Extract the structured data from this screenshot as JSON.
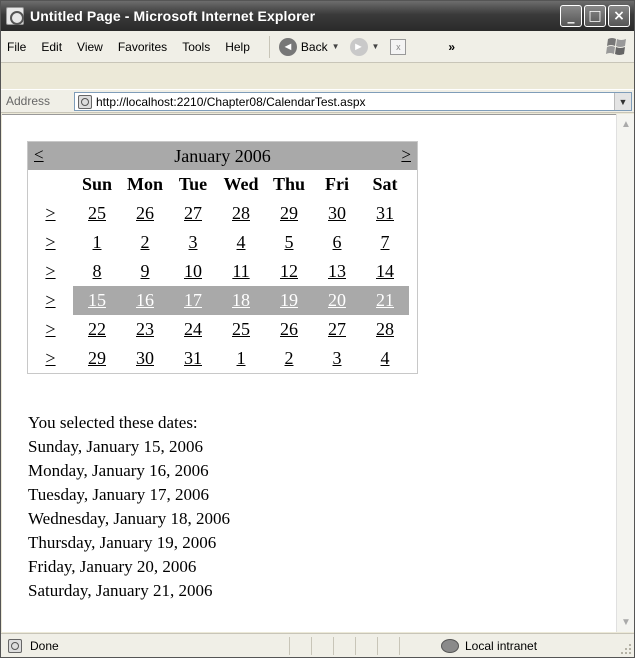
{
  "window": {
    "title": "Untitled Page - Microsoft Internet Explorer",
    "minimize": "_",
    "maximize": "□",
    "close": "×"
  },
  "menu": {
    "file": "File",
    "edit": "Edit",
    "view": "View",
    "favorites": "Favorites",
    "tools": "Tools",
    "help": "Help"
  },
  "toolbar": {
    "back": "Back",
    "back_glyph": "◄",
    "forward_glyph": "►",
    "dropdown": "▼",
    "stop_glyph": "x",
    "chevrons": "»"
  },
  "address": {
    "label": "Address",
    "url": "http://localhost:2210/Chapter08/CalendarTest.aspx"
  },
  "calendar": {
    "title": "January 2006",
    "prev": "<",
    "next": ">",
    "week_select": ">",
    "days_of_week": [
      "Sun",
      "Mon",
      "Tue",
      "Wed",
      "Thu",
      "Fri",
      "Sat"
    ],
    "weeks": [
      [
        "25",
        "26",
        "27",
        "28",
        "29",
        "30",
        "31"
      ],
      [
        "1",
        "2",
        "3",
        "4",
        "5",
        "6",
        "7"
      ],
      [
        "8",
        "9",
        "10",
        "11",
        "12",
        "13",
        "14"
      ],
      [
        "15",
        "16",
        "17",
        "18",
        "19",
        "20",
        "21"
      ],
      [
        "22",
        "23",
        "24",
        "25",
        "26",
        "27",
        "28"
      ],
      [
        "29",
        "30",
        "31",
        "1",
        "2",
        "3",
        "4"
      ]
    ],
    "selected_week_index": 3,
    "selected_color": "#a9a9a9"
  },
  "selection": {
    "heading": "You selected these dates:",
    "dates": [
      "Sunday, January 15, 2006",
      "Monday, January 16, 2006",
      "Tuesday, January 17, 2006",
      "Wednesday, January 18, 2006",
      "Thursday, January 19, 2006",
      "Friday, January 20, 2006",
      "Saturday, January 21, 2006"
    ]
  },
  "status": {
    "text": "Done",
    "zone": "Local intranet"
  }
}
